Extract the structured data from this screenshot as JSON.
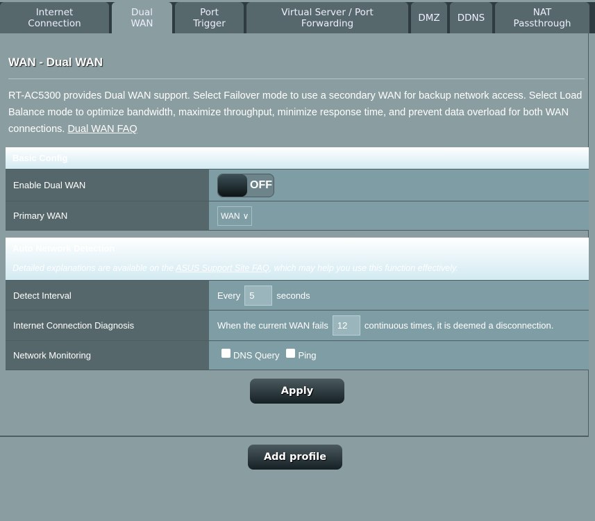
{
  "tabs": [
    {
      "label": "Internet\nConnection",
      "active": false
    },
    {
      "label": "Dual\nWAN",
      "active": true
    },
    {
      "label": "Port\nTrigger",
      "active": false
    },
    {
      "label": "Virtual Server / Port\nForwarding",
      "active": false
    },
    {
      "label": "DMZ",
      "active": false
    },
    {
      "label": "DDNS",
      "active": false
    },
    {
      "label": "NAT\nPassthrough",
      "active": false
    }
  ],
  "page_title": "WAN - Dual WAN",
  "description": "RT-AC5300 provides Dual WAN support. Select Failover mode to use a secondary WAN for backup network access. Select Load Balance mode to optimize bandwidth, maximize throughput, minimize response time, and prevent data overload for both WAN connections. ",
  "faq_link": "Dual WAN FAQ",
  "basic_config": {
    "title": "Basic Config",
    "enable_label": "Enable Dual WAN",
    "enable_state": "OFF",
    "primary_label": "Primary WAN",
    "primary_value": "WAN"
  },
  "detection": {
    "title": "Auto Network Detection",
    "note_prefix": "Detailed explanations are available on the ",
    "note_link": "ASUS Support Site FAQ",
    "note_suffix": ", which may help you use this function effectively.",
    "interval_label": "Detect Interval",
    "interval_prefix": "Every",
    "interval_value": "5",
    "interval_suffix": "seconds",
    "diag_label": "Internet Connection Diagnosis",
    "diag_prefix": "When the current WAN fails",
    "diag_value": "12",
    "diag_suffix": "continuous times, it is deemed a disconnection.",
    "monitor_label": "Network Monitoring",
    "dns_label": "DNS Query",
    "dns_checked": false,
    "ping_label": "Ping",
    "ping_checked": false
  },
  "apply_label": "Apply",
  "add_profile_label": "Add profile"
}
